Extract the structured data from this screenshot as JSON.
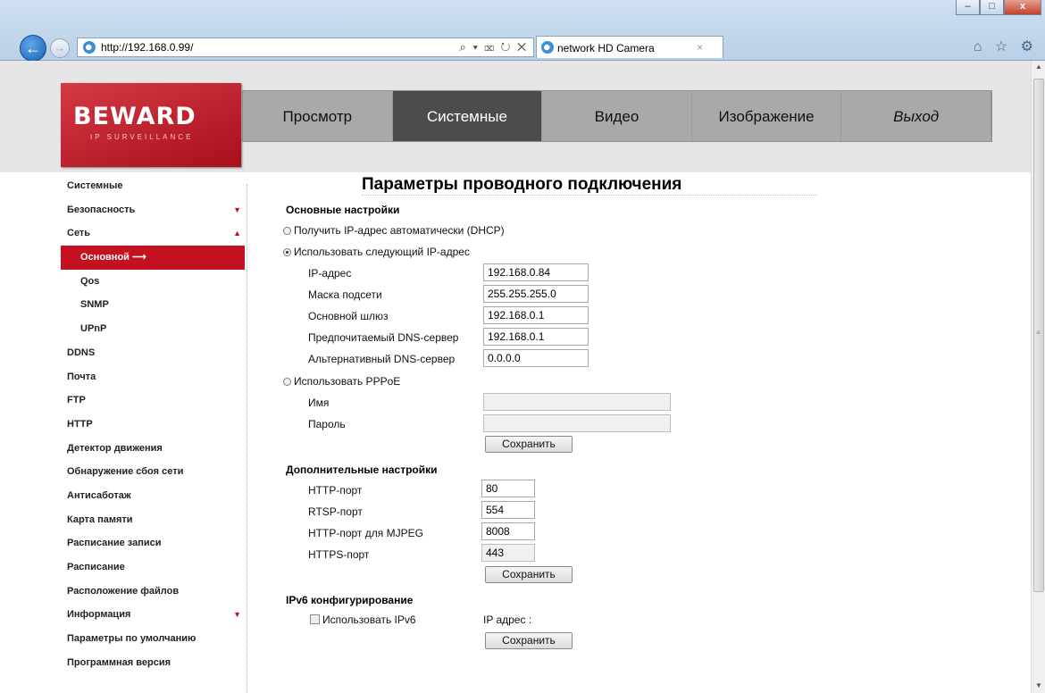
{
  "browser": {
    "url": "http://192.168.0.99/",
    "address_actions": "⌕ ▾ ⌧ ↻ ✕",
    "tab_title": "network HD Camera",
    "tab_close": "×",
    "back_glyph": "←",
    "forward_glyph": "→",
    "window_min": "–",
    "window_max": "□",
    "window_close": "x",
    "toolbar_icons": "⌂ ☆ ⚙"
  },
  "logo": {
    "brand": "BEWARD",
    "tagline": "IP SURVEILLANCE"
  },
  "menu": [
    {
      "label": "Просмотр"
    },
    {
      "label": "Системные"
    },
    {
      "label": "Видео"
    },
    {
      "label": "Изображение"
    },
    {
      "label": "Выход"
    }
  ],
  "sidebar": [
    {
      "label": "Системные"
    },
    {
      "label": "Безопасность",
      "arrow": "▼"
    },
    {
      "label": "Сеть",
      "arrow": "▲"
    },
    {
      "label": "Основной ⟶"
    },
    {
      "label": "Qos"
    },
    {
      "label": "SNMP"
    },
    {
      "label": "UPnP"
    },
    {
      "label": "DDNS"
    },
    {
      "label": "Почта"
    },
    {
      "label": "FTP"
    },
    {
      "label": "HTTP"
    },
    {
      "label": "Детектор движения"
    },
    {
      "label": "Обнаружение сбоя сети"
    },
    {
      "label": "Антисаботаж"
    },
    {
      "label": "Карта памяти"
    },
    {
      "label": "Расписание записи"
    },
    {
      "label": "Расписание"
    },
    {
      "label": "Расположение файлов"
    },
    {
      "label": "Информация",
      "arrow": "▼"
    },
    {
      "label": "Параметры по умолчанию"
    },
    {
      "label": "Программная версия"
    }
  ],
  "form": {
    "title": "Параметры проводного подключения",
    "basic_title": "Основные настройки",
    "dhcp_label": "Получить IP-адрес автоматически (DHCP)",
    "static_label": "Использовать следующий IP-адрес",
    "ip_label": "IP-адрес",
    "ip_value": "192.168.0.84",
    "mask_label": "Маска подсети",
    "mask_value": "255.255.255.0",
    "gateway_label": "Основной шлюз",
    "gateway_value": "192.168.0.1",
    "dns1_label": "Предпочитаемый DNS-сервер",
    "dns1_value": "192.168.0.1",
    "dns2_label": "Альтернативный DNS-сервер",
    "dns2_value": "0.0.0.0",
    "pppoe_label": "Использовать PPPoE",
    "name_label": "Имя",
    "name_value": "",
    "password_label": "Пароль",
    "password_value": "",
    "save_label": "Сохранить",
    "advanced_title": "Дополнительные настройки",
    "http_port_label": "HTTP-порт",
    "http_port_value": "80",
    "rtsp_port_label": "RTSP-порт",
    "rtsp_port_value": "554",
    "mjpeg_port_label": "HTTP-порт для MJPEG",
    "mjpeg_port_value": "8008",
    "https_port_label": "HTTPS-порт",
    "https_port_value": "443",
    "ipv6_title": "IPv6 конфигурирование",
    "ipv6_use_label": "Использовать IPv6",
    "ipv6_address_label": "IP адрес :"
  }
}
